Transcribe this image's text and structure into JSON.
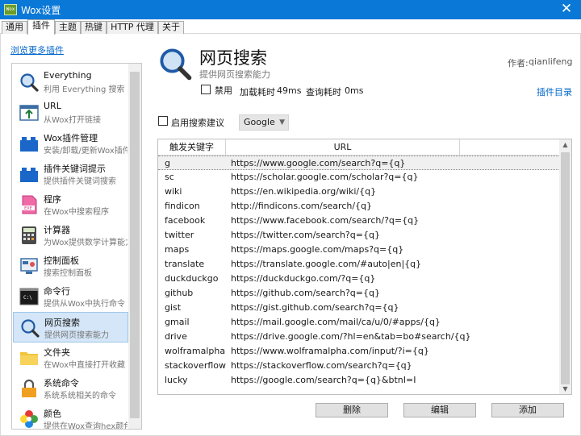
{
  "window": {
    "title": "Wox设置",
    "app_icon_text": "Wox",
    "close_glyph": "✕"
  },
  "tabs": [
    {
      "label": "通用"
    },
    {
      "label": "插件"
    },
    {
      "label": "主题"
    },
    {
      "label": "热键"
    },
    {
      "label": "HTTP 代理"
    },
    {
      "label": "关于"
    }
  ],
  "active_tab": "插件",
  "browse_more_label": "浏览更多插件",
  "plugins": [
    {
      "name": "Everything",
      "desc": "利用 Everything 搜索",
      "icon": "magnifier-icon"
    },
    {
      "name": "URL",
      "desc": "从Wox打开链接",
      "icon": "url-icon"
    },
    {
      "name": "Wox插件管理",
      "desc": "安装/卸载/更新Wox插件",
      "icon": "plugin-blocks-icon"
    },
    {
      "name": "插件关键词提示",
      "desc": "提供插件关键词搜索",
      "icon": "plugin-blocks-icon"
    },
    {
      "name": "程序",
      "desc": "在Wox中搜索程序",
      "icon": "exe-icon"
    },
    {
      "name": "计算器",
      "desc": "为Wox提供数学计算能力",
      "icon": "calculator-icon"
    },
    {
      "name": "控制面板",
      "desc": "搜索控制面板",
      "icon": "control-panel-icon"
    },
    {
      "name": "命令行",
      "desc": "提供从Wox中执行命令",
      "icon": "terminal-icon"
    },
    {
      "name": "网页搜索",
      "desc": "提供网页搜索能力",
      "icon": "magnifier-icon"
    },
    {
      "name": "文件夹",
      "desc": "在Wox中直接打开收藏",
      "icon": "folder-icon"
    },
    {
      "name": "系统命令",
      "desc": "系统系统相关的命令",
      "icon": "lock-icon"
    },
    {
      "name": "颜色",
      "desc": "提供在Wox查询hex颜色",
      "icon": "color-flower-icon"
    }
  ],
  "selected_plugin": "网页搜索",
  "detail": {
    "title": "网页搜索",
    "subtitle": "提供网页搜索能力",
    "author_label": "作者:",
    "author": "qianlifeng",
    "disable_label": "禁用",
    "load_time_label": "加载耗时",
    "load_time": "49ms",
    "query_time_label": "查询耗时",
    "query_time": "0ms",
    "plugin_dir_label": "插件目录",
    "enable_suggestion_label": "启用搜索建议",
    "suggestion_engine": "Google"
  },
  "table": {
    "headers": {
      "keyword": "触发关键字",
      "url": "URL"
    },
    "rows": [
      {
        "keyword": "g",
        "url": "https://www.google.com/search?q={q}"
      },
      {
        "keyword": "sc",
        "url": "https://scholar.google.com/scholar?q={q}"
      },
      {
        "keyword": "wiki",
        "url": "https://en.wikipedia.org/wiki/{q}"
      },
      {
        "keyword": "findicon",
        "url": "http://findicons.com/search/{q}"
      },
      {
        "keyword": "facebook",
        "url": "https://www.facebook.com/search/?q={q}"
      },
      {
        "keyword": "twitter",
        "url": "https://twitter.com/search?q={q}"
      },
      {
        "keyword": "maps",
        "url": "https://maps.google.com/maps?q={q}"
      },
      {
        "keyword": "translate",
        "url": "https://translate.google.com/#auto|en|{q}"
      },
      {
        "keyword": "duckduckgo",
        "url": "https://duckduckgo.com/?q={q}"
      },
      {
        "keyword": "github",
        "url": "https://github.com/search?q={q}"
      },
      {
        "keyword": "gist",
        "url": "https://gist.github.com/search?q={q}"
      },
      {
        "keyword": "gmail",
        "url": "https://mail.google.com/mail/ca/u/0/#apps/{q}"
      },
      {
        "keyword": "drive",
        "url": "https://drive.google.com/?hl=en&tab=bo#search/{q}"
      },
      {
        "keyword": "wolframalpha",
        "url": "https://www.wolframalpha.com/input/?i={q}"
      },
      {
        "keyword": "stackoverflow",
        "url": "https://stackoverflow.com/search?q={q}"
      },
      {
        "keyword": "lucky",
        "url": "https://google.com/search?q={q}&btnI=I"
      }
    ]
  },
  "buttons": {
    "delete": "删除",
    "edit": "编辑",
    "add": "添加"
  },
  "colors": {
    "titlebar": "#0a78d7",
    "link": "#0066cc",
    "selection": "#d4e6f7"
  }
}
